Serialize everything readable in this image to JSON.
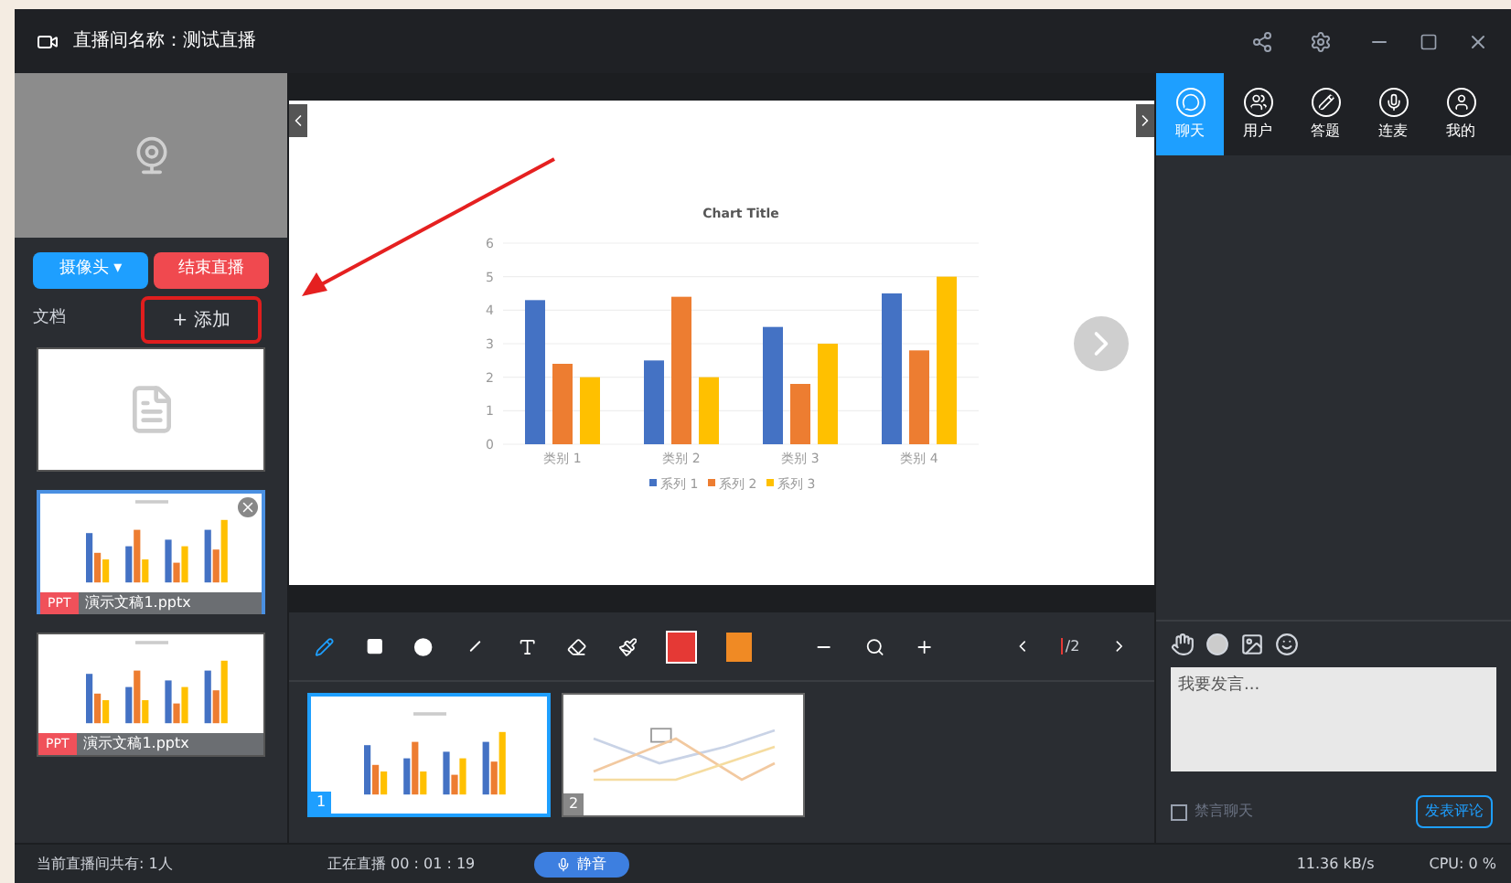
{
  "window": {
    "title": "直播间名称：测试直播"
  },
  "left_panel": {
    "camera_button": "摄像头 ▾",
    "end_button": "结束直播",
    "docs_label": "文档",
    "add_button": "+ 添加",
    "documents": [
      {
        "kind": "empty",
        "selected": false
      },
      {
        "kind": "ppt",
        "badge": "PPT",
        "name": "演示文稿1.pptx",
        "selected": true
      },
      {
        "kind": "ppt",
        "badge": "PPT",
        "name": "演示文稿1.pptx",
        "selected": false
      }
    ]
  },
  "slide": {
    "chart_data": {
      "type": "bar",
      "title": "Chart Title",
      "categories": [
        "类别 1",
        "类别 2",
        "类别 3",
        "类别 4"
      ],
      "series": [
        {
          "name": "系列 1",
          "color": "#4472c4",
          "values": [
            4.3,
            2.5,
            3.5,
            4.5
          ]
        },
        {
          "name": "系列 2",
          "color": "#ed7d31",
          "values": [
            2.4,
            4.4,
            1.8,
            2.8
          ]
        },
        {
          "name": "系列 3",
          "color": "#ffc000",
          "values": [
            2,
            2,
            3,
            5
          ]
        }
      ],
      "ylim": [
        0,
        6
      ],
      "yticks": [
        0,
        1,
        2,
        3,
        4,
        5,
        6
      ],
      "grid": true,
      "legend": true
    }
  },
  "toolbar": {
    "colors": [
      {
        "color": "#e53935",
        "selected": true
      },
      {
        "color": "#f08a24",
        "selected": false
      }
    ],
    "page": "/2"
  },
  "thumbnails": [
    {
      "number": "1",
      "kind": "bar",
      "selected": true
    },
    {
      "number": "2",
      "kind": "line",
      "selected": false
    }
  ],
  "right_tabs": [
    {
      "label": "聊天",
      "selected": true
    },
    {
      "label": "用户",
      "selected": false
    },
    {
      "label": "答题",
      "selected": false
    },
    {
      "label": "连麦",
      "selected": false
    },
    {
      "label": "我的",
      "selected": false
    }
  ],
  "chat": {
    "placeholder": "我要发言...",
    "mute_checkbox": {
      "label": "禁言聊天",
      "checked": false
    },
    "send_button": "发表评论"
  },
  "status_bar": {
    "viewers": "当前直播间共有: 1人",
    "live_time": "正在直播 00 : 01 : 19",
    "mute_button": "静音",
    "speed": "11.36 kB/s",
    "cpu": "CPU: 0 %"
  }
}
